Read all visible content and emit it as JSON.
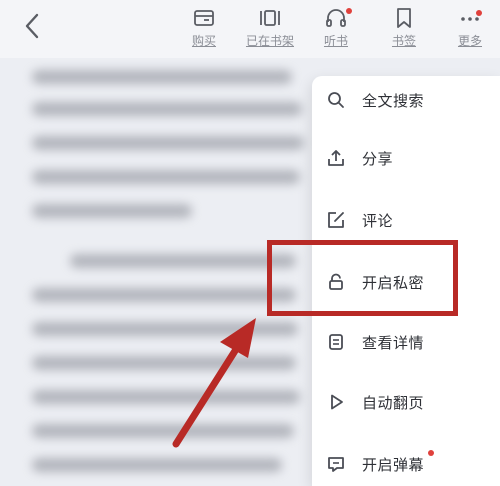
{
  "toolbar": {
    "back_icon": "chevron-left-icon",
    "buttons": [
      {
        "label": "购买",
        "icon": "wallet-icon"
      },
      {
        "label": "已在书架",
        "icon": "bookshelf-icon"
      },
      {
        "label": "听书",
        "icon": "headphones-icon",
        "badge": true
      },
      {
        "label": "书签",
        "icon": "bookmark-icon"
      },
      {
        "label": "更多",
        "icon": "more-dots-icon",
        "badge": true
      }
    ]
  },
  "menu": {
    "items": [
      {
        "label": "全文搜索",
        "icon": "search-icon"
      },
      {
        "label": "分享",
        "icon": "share-icon"
      },
      {
        "label": "评论",
        "icon": "edit-icon"
      },
      {
        "label": "开启私密",
        "icon": "lock-icon"
      },
      {
        "label": "查看详情",
        "icon": "details-icon"
      },
      {
        "label": "自动翻页",
        "icon": "play-icon"
      },
      {
        "label": "开启弹幕",
        "icon": "comment-icon",
        "badge": true
      }
    ]
  },
  "colors": {
    "background": "#eceef3",
    "highlight": "#b82a26",
    "badge": "#e0413c"
  }
}
